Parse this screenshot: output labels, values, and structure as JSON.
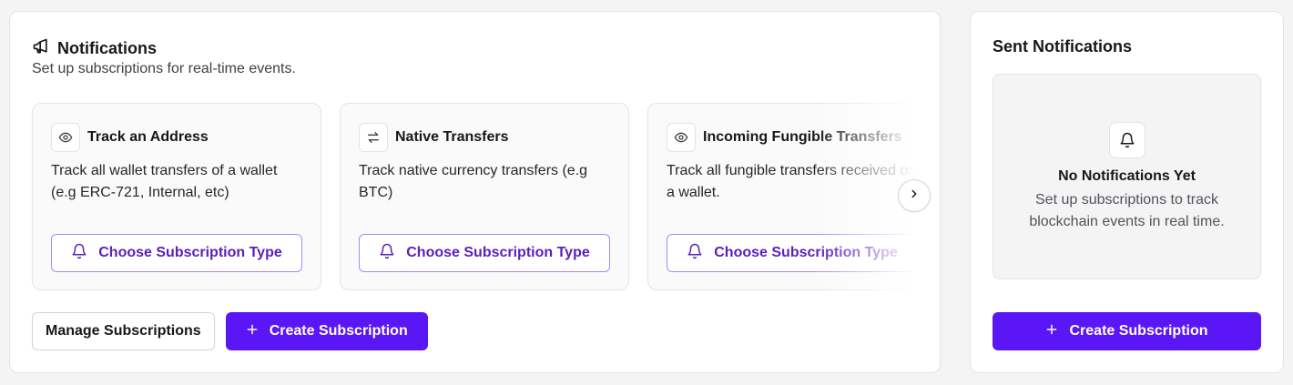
{
  "colors": {
    "accent": "#5b16f5",
    "accent_text": "#5b21b6",
    "accent_border": "#a78bfa"
  },
  "notifications": {
    "icon": "megaphone-icon",
    "title": "Notifications",
    "subtitle": "Set up subscriptions for real-time events.",
    "cards": [
      {
        "icon": "eye-icon",
        "title": "Track an Address",
        "description": "Track all wallet transfers of a wallet (e.g ERC-721, Internal, etc)",
        "button_label": "Choose Subscription Type"
      },
      {
        "icon": "arrows-swap-icon",
        "title": "Native Transfers",
        "description": "Track native currency transfers (e.g BTC)",
        "button_label": "Choose Subscription Type"
      },
      {
        "icon": "eye-icon",
        "title": "Incoming Fungible Transfers",
        "description": "Track all fungible transfers received on a wallet.",
        "button_label": "Choose Subscription Type"
      }
    ],
    "next_icon": "chevron-right-icon",
    "manage_label": "Manage Subscriptions",
    "create_label": "Create Subscription"
  },
  "sent": {
    "title": "Sent Notifications",
    "empty_icon": "bell-icon",
    "empty_title": "No Notifications Yet",
    "empty_description": "Set up subscriptions to track blockchain events in real time.",
    "create_label": "Create Subscription"
  }
}
